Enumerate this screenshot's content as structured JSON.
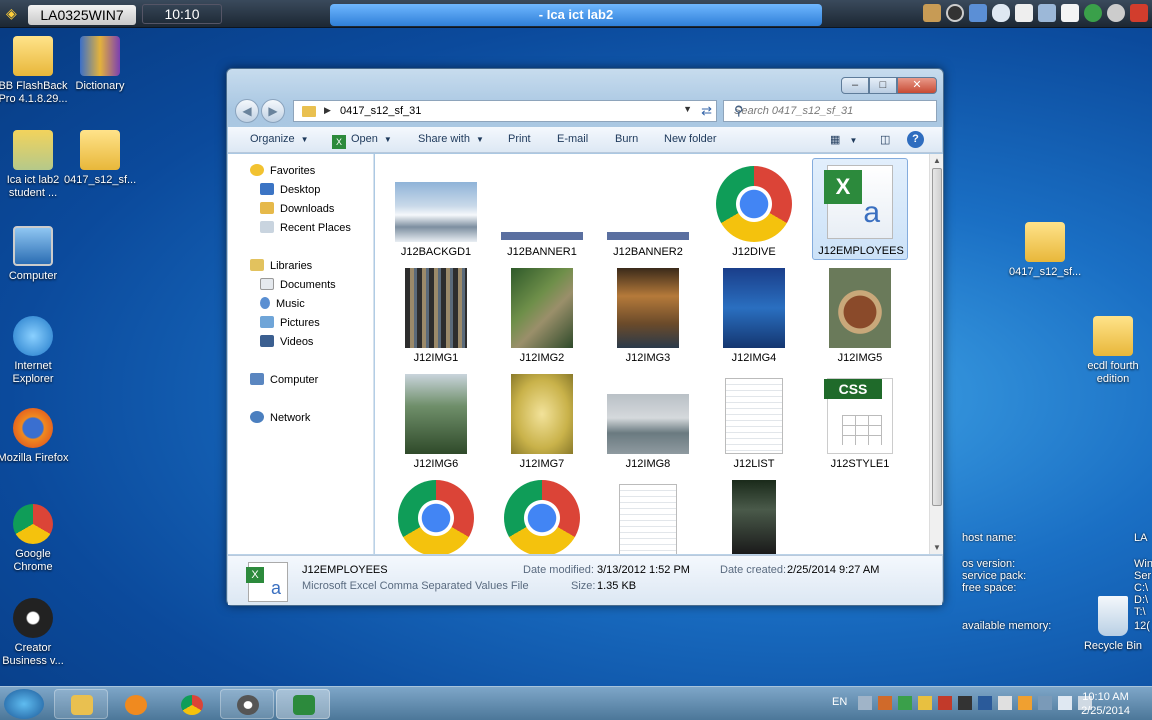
{
  "topbar": {
    "host": "LA0325WIN7",
    "time": "10:10",
    "session": "- Ica ict lab2"
  },
  "desktop_icons": [
    {
      "label": "BB FlashBack Pro 4.1.8.29...",
      "icon": "folder-icon"
    },
    {
      "label": "Dictionary",
      "icon": "books-icon"
    },
    {
      "label": "Ica ict lab2 student ...",
      "icon": "remote-desktop-icon"
    },
    {
      "label": "0417_s12_sf...",
      "icon": "folder-icon"
    },
    {
      "label": "Computer",
      "icon": "computer-icon"
    },
    {
      "label": "Internet Explorer",
      "icon": "ie-icon"
    },
    {
      "label": "Mozilla Firefox",
      "icon": "firefox-icon"
    },
    {
      "label": "Google Chrome",
      "icon": "chrome-icon"
    },
    {
      "label": "Creator Business v...",
      "icon": "creator-icon"
    },
    {
      "label": "0417_s12_sf...",
      "icon": "zip-folder-icon"
    },
    {
      "label": "ecdl fourth edition",
      "icon": "folder-icon"
    },
    {
      "label": "Recycle Bin",
      "icon": "recycle-bin-icon"
    }
  ],
  "explorer": {
    "breadcrumb": "0417_s12_sf_31",
    "search_placeholder": "Search 0417_s12_sf_31",
    "toolbar": {
      "organize": "Organize",
      "open": "Open",
      "share": "Share with",
      "print": "Print",
      "email": "E-mail",
      "burn": "Burn",
      "new_folder": "New folder"
    },
    "nav": {
      "favorites": "Favorites",
      "desktop": "Desktop",
      "downloads": "Downloads",
      "recent": "Recent Places",
      "libraries": "Libraries",
      "documents": "Documents",
      "music": "Music",
      "pictures": "Pictures",
      "videos": "Videos",
      "computer": "Computer",
      "network": "Network"
    },
    "files": [
      {
        "name": "J12BACKGD1",
        "kind": "photo-snow"
      },
      {
        "name": "J12BANNER1",
        "kind": "banner"
      },
      {
        "name": "J12BANNER2",
        "kind": "banner"
      },
      {
        "name": "J12DIVE",
        "kind": "chrome"
      },
      {
        "name": "J12EMPLOYEES",
        "kind": "excel",
        "selected": true
      },
      {
        "name": "J12IMG1",
        "kind": "photo"
      },
      {
        "name": "J12IMG2",
        "kind": "photo"
      },
      {
        "name": "J12IMG3",
        "kind": "photo"
      },
      {
        "name": "J12IMG4",
        "kind": "photo-dive"
      },
      {
        "name": "J12IMG5",
        "kind": "photo"
      },
      {
        "name": "J12IMG6",
        "kind": "photo"
      },
      {
        "name": "J12IMG7",
        "kind": "photo-yellow"
      },
      {
        "name": "J12IMG8",
        "kind": "photo-gray"
      },
      {
        "name": "J12LIST",
        "kind": "doc"
      },
      {
        "name": "J12STYLE1",
        "kind": "css"
      }
    ],
    "details": {
      "name": "J12EMPLOYEES",
      "type": "Microsoft Excel Comma Separated Values File",
      "modified_label": "Date modified:",
      "modified": "3/13/2012 1:52 PM",
      "size_label": "Size:",
      "size": "1.35 KB",
      "created_label": "Date created:",
      "created": "2/25/2014 9:27 AM"
    }
  },
  "bginfo": {
    "host_label": "host name:",
    "os_label": "os version:",
    "sp_label": "service pack:",
    "free_label": "free space:",
    "mem_label": "available memory:",
    "host_val": "LA",
    "os_val": "Win",
    "sp_val": "Ser",
    "c_val": "C:\\",
    "d_val": "D:\\",
    "t_val": "T:\\",
    "mem_val": "12("
  },
  "taskbar": {
    "lang": "EN",
    "clock_time": "10:10 AM",
    "clock_date": "2/25/2014"
  }
}
